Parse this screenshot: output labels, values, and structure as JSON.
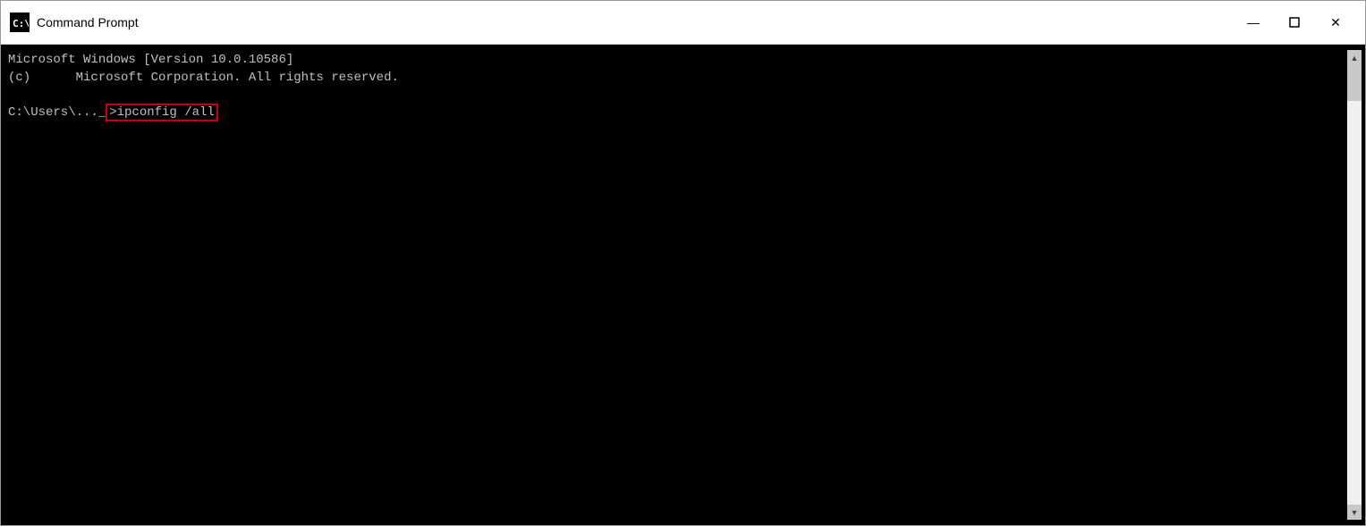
{
  "window": {
    "title": "Command Prompt",
    "icon": "cmd-icon"
  },
  "titlebar": {
    "title": "Command Prompt",
    "minimize_label": "—",
    "maximize_label": "🗖",
    "close_label": "✕"
  },
  "terminal": {
    "lines": [
      "Microsoft Windows [Version 10.0.10586]",
      "(c)      Microsoft Corporation. All rights reserved.",
      "",
      "C:\\Users\\..._"
    ],
    "command_prompt": "C:\\Users\\..._",
    "command": ">ipconfig /all",
    "prompt_prefix": "C:\\Users\\..._",
    "scrollbar_arrow_up": "▲",
    "scrollbar_arrow_down": "▼"
  }
}
